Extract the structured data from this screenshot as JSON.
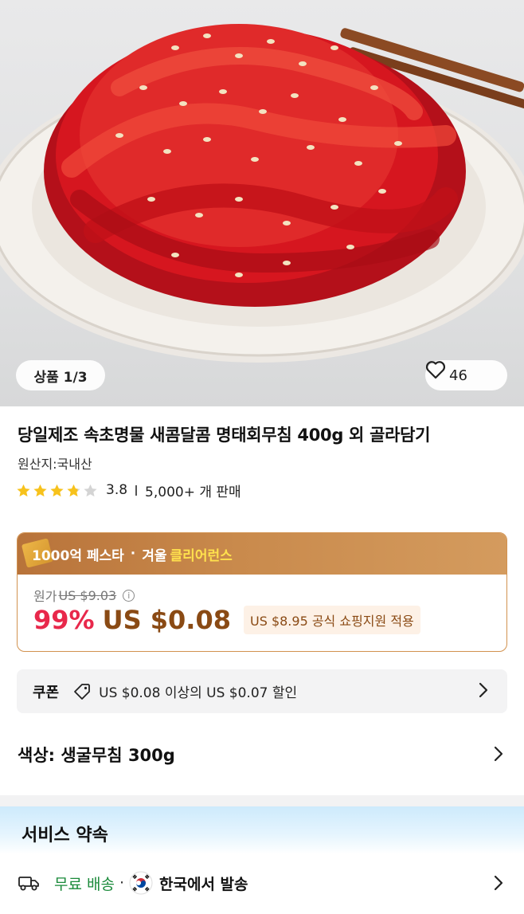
{
  "gallery": {
    "counter": "상품 1/3",
    "like_count": "46"
  },
  "product": {
    "title": "당일제조 속초명물 새콤달콤 명태회무침 400g 외 골라담기",
    "origin": "원산지:국내산",
    "rating": 3.8,
    "rating_text": "3.8",
    "sold_text": "5,000+ 개 판매"
  },
  "promo": {
    "part1": "1000억 페스타",
    "dot": "·",
    "part2": "겨울",
    "part3": "클리어런스"
  },
  "price": {
    "original_label": "원가",
    "original_value": "US $9.03",
    "discount": "99%",
    "current": "US $0.08",
    "subsidy": "US $8.95 공식 쇼핑지원 적용"
  },
  "coupon": {
    "label": "쿠폰",
    "text": "US $0.08 이상의 US $0.07 할인"
  },
  "option": {
    "text": "색상: 생굴무침 300g"
  },
  "service": {
    "title": "서비스 약속",
    "free_shipping": "무료 배송",
    "dot": "·",
    "ships_from": "한국에서 발송"
  },
  "colors": {
    "discount_red": "#e8284b",
    "price_brown": "#8a4a14",
    "free_green": "#1a8a3a",
    "star_yellow": "#f7c21c",
    "promo_gold": "#c98a4c"
  },
  "icons": {
    "heart": "heart-icon",
    "info": "info-icon",
    "coupon_tag": "tag-icon",
    "chevron": "chevron-right-icon",
    "truck": "truck-icon",
    "flag": "korea-flag-icon"
  }
}
